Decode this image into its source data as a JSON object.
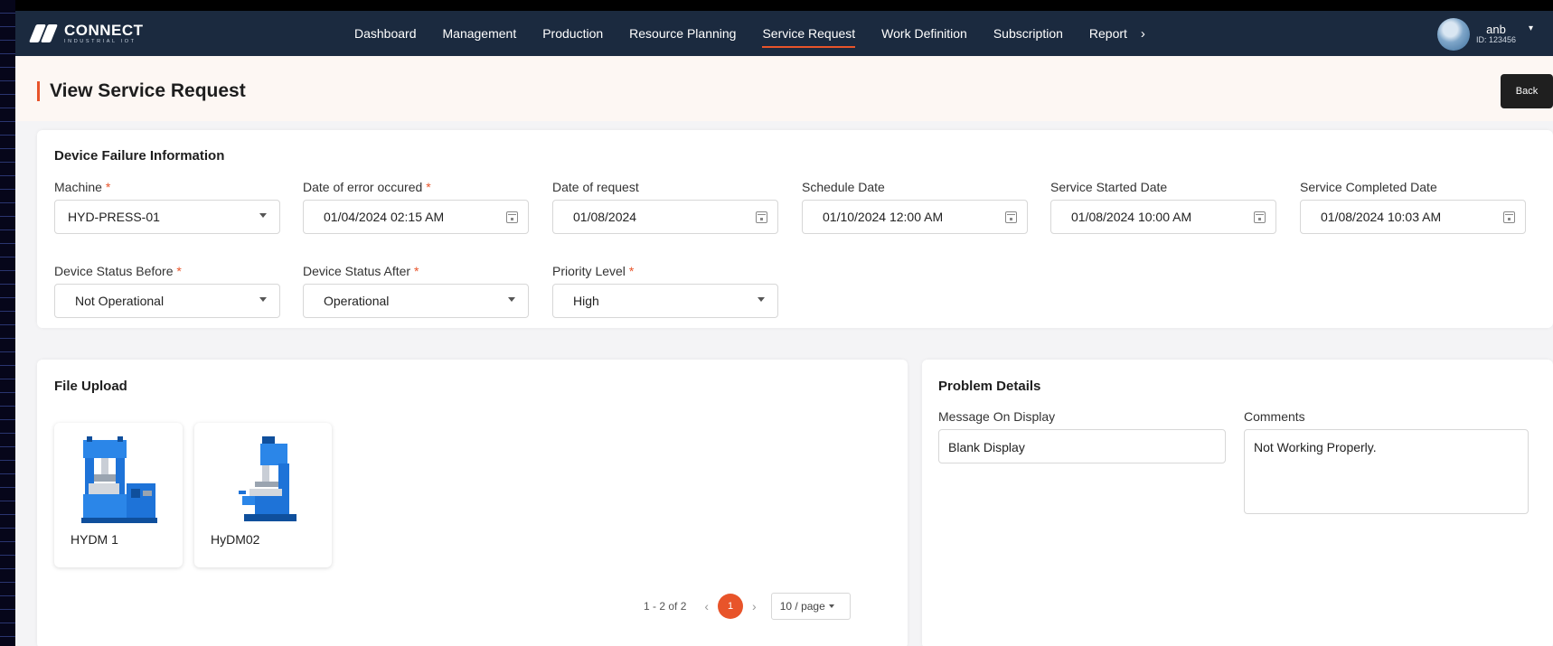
{
  "app": {
    "brand": "CONNECT",
    "brand_sub": "INDUSTRIAL IOT"
  },
  "nav": {
    "items": [
      {
        "label": "Dashboard"
      },
      {
        "label": "Management"
      },
      {
        "label": "Production"
      },
      {
        "label": "Resource Planning"
      },
      {
        "label": "Service Request"
      },
      {
        "label": "Work Definition"
      },
      {
        "label": "Subscription"
      },
      {
        "label": "Report"
      }
    ],
    "active": "Service Request",
    "more": "›"
  },
  "user": {
    "name": "anb",
    "id": "ID: 123456"
  },
  "page": {
    "title": "View Service Request",
    "back_label": "Back"
  },
  "device_failure": {
    "title": "Device Failure Information",
    "fields": {
      "machine": {
        "label": "Machine",
        "required": "*",
        "value": "HYD-PRESS-01"
      },
      "error_date": {
        "label": "Date of error occured",
        "required": "*",
        "value": "01/04/2024 02:15 AM"
      },
      "request_date": {
        "label": "Date of request",
        "value": "01/08/2024"
      },
      "schedule_date": {
        "label": "Schedule Date",
        "value": "01/10/2024 12:00 AM"
      },
      "service_started": {
        "label": "Service Started Date",
        "value": "01/08/2024 10:00 AM"
      },
      "service_completed": {
        "label": "Service Completed Date",
        "value": "01/08/2024 10:03 AM"
      },
      "status_before": {
        "label": "Device Status Before",
        "required": "*",
        "value": "Not Operational"
      },
      "status_after": {
        "label": "Device Status After",
        "required": "*",
        "value": "Operational"
      },
      "priority": {
        "label": "Priority Level",
        "required": "*",
        "value": "High"
      }
    }
  },
  "file_upload": {
    "title": "File Upload",
    "files": [
      {
        "name": "HYDM 1"
      },
      {
        "name": "HyDM02"
      }
    ],
    "pagination": {
      "total": "1 - 2 of 2",
      "prev": "‹",
      "current": "1",
      "next": "›",
      "page_size": "10 / page"
    }
  },
  "problem_details": {
    "title": "Problem Details",
    "message_label": "Message On Display",
    "message_value": "Blank Display",
    "comments_label": "Comments",
    "comments_value": "Not Working Properly."
  },
  "colors": {
    "nav_bg": "#1b2a3f",
    "accent": "#e8542a",
    "page_bg": "#f4f4f6",
    "header_bg": "#fdf7f3",
    "machine_blue": "#1e73d8"
  }
}
